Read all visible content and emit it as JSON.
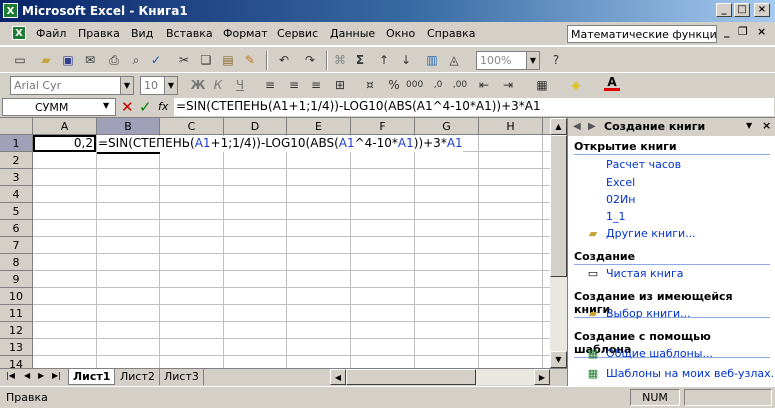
{
  "window": {
    "title": "Microsoft Excel - Книга1"
  },
  "menu": {
    "items": [
      "Файл",
      "Правка",
      "Вид",
      "Вставка",
      "Формат",
      "Сервис",
      "Данные",
      "Окно",
      "Справка"
    ],
    "help_box": "Математические функции"
  },
  "toolbar": {
    "zoom": "100%",
    "font_name": "Arial Cyr",
    "font_size": "10",
    "bold": "Ж",
    "italic": "К",
    "underline": "Ч"
  },
  "formula_bar": {
    "name_box": "СУММ",
    "fx": "fx",
    "formula": "=SIN(СТЕПЕНЬ(A1+1;1/4))-LOG10(ABS(A1^4-10*A1))+3*A1"
  },
  "sheet": {
    "columns": [
      "A",
      "B",
      "C",
      "D",
      "E",
      "F",
      "G",
      "H"
    ],
    "rows": [
      "1",
      "2",
      "3",
      "4",
      "5",
      "6",
      "7",
      "8",
      "9",
      "10",
      "11",
      "12",
      "13",
      "14"
    ],
    "cells": {
      "A1": "0,2",
      "B1_parts": [
        "=SIN(СТЕПЕНЬ(",
        "A1",
        "+1;1/4))-LOG10(ABS(",
        "A1",
        "^4-10*",
        "A1",
        "))+3*",
        "A1"
      ]
    },
    "tabs": [
      "Лист1",
      "Лист2",
      "Лист3"
    ]
  },
  "status": {
    "left": "Правка",
    "num": "NUM"
  },
  "task_pane": {
    "title": "Создание книги",
    "open_section": "Открытие книги",
    "recent": [
      "Расчет часов",
      "Excel",
      "02Ин",
      "1_1"
    ],
    "more_books": "Другие книги...",
    "new_section": "Создание",
    "blank_book": "Чистая книга",
    "from_existing_section": "Создание из имеющейся книги",
    "choose_book": "Выбор книги...",
    "template_section": "Создание с помощью шаблона",
    "general_templates": "Общие шаблоны...",
    "website_templates": "Шаблоны на моих веб-узлах..."
  },
  "colors": {
    "title_start": "#0a246a",
    "title_end": "#a6caf0",
    "ref_blue": "#1f3fc8",
    "link": "#0033cc"
  }
}
